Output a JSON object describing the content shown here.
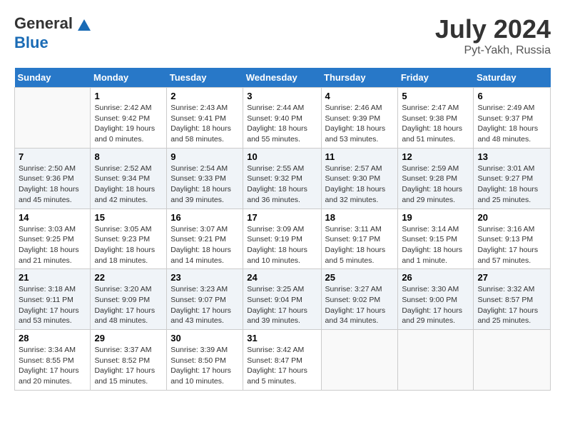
{
  "header": {
    "logo_general": "General",
    "logo_blue": "Blue",
    "month_year": "July 2024",
    "location": "Pyt-Yakh, Russia"
  },
  "days_of_week": [
    "Sunday",
    "Monday",
    "Tuesday",
    "Wednesday",
    "Thursday",
    "Friday",
    "Saturday"
  ],
  "weeks": [
    [
      {
        "day": "",
        "info": ""
      },
      {
        "day": "1",
        "info": "Sunrise: 2:42 AM\nSunset: 9:42 PM\nDaylight: 19 hours\nand 0 minutes."
      },
      {
        "day": "2",
        "info": "Sunrise: 2:43 AM\nSunset: 9:41 PM\nDaylight: 18 hours\nand 58 minutes."
      },
      {
        "day": "3",
        "info": "Sunrise: 2:44 AM\nSunset: 9:40 PM\nDaylight: 18 hours\nand 55 minutes."
      },
      {
        "day": "4",
        "info": "Sunrise: 2:46 AM\nSunset: 9:39 PM\nDaylight: 18 hours\nand 53 minutes."
      },
      {
        "day": "5",
        "info": "Sunrise: 2:47 AM\nSunset: 9:38 PM\nDaylight: 18 hours\nand 51 minutes."
      },
      {
        "day": "6",
        "info": "Sunrise: 2:49 AM\nSunset: 9:37 PM\nDaylight: 18 hours\nand 48 minutes."
      }
    ],
    [
      {
        "day": "7",
        "info": "Sunrise: 2:50 AM\nSunset: 9:36 PM\nDaylight: 18 hours\nand 45 minutes."
      },
      {
        "day": "8",
        "info": "Sunrise: 2:52 AM\nSunset: 9:34 PM\nDaylight: 18 hours\nand 42 minutes."
      },
      {
        "day": "9",
        "info": "Sunrise: 2:54 AM\nSunset: 9:33 PM\nDaylight: 18 hours\nand 39 minutes."
      },
      {
        "day": "10",
        "info": "Sunrise: 2:55 AM\nSunset: 9:32 PM\nDaylight: 18 hours\nand 36 minutes."
      },
      {
        "day": "11",
        "info": "Sunrise: 2:57 AM\nSunset: 9:30 PM\nDaylight: 18 hours\nand 32 minutes."
      },
      {
        "day": "12",
        "info": "Sunrise: 2:59 AM\nSunset: 9:28 PM\nDaylight: 18 hours\nand 29 minutes."
      },
      {
        "day": "13",
        "info": "Sunrise: 3:01 AM\nSunset: 9:27 PM\nDaylight: 18 hours\nand 25 minutes."
      }
    ],
    [
      {
        "day": "14",
        "info": "Sunrise: 3:03 AM\nSunset: 9:25 PM\nDaylight: 18 hours\nand 21 minutes."
      },
      {
        "day": "15",
        "info": "Sunrise: 3:05 AM\nSunset: 9:23 PM\nDaylight: 18 hours\nand 18 minutes."
      },
      {
        "day": "16",
        "info": "Sunrise: 3:07 AM\nSunset: 9:21 PM\nDaylight: 18 hours\nand 14 minutes."
      },
      {
        "day": "17",
        "info": "Sunrise: 3:09 AM\nSunset: 9:19 PM\nDaylight: 18 hours\nand 10 minutes."
      },
      {
        "day": "18",
        "info": "Sunrise: 3:11 AM\nSunset: 9:17 PM\nDaylight: 18 hours\nand 5 minutes."
      },
      {
        "day": "19",
        "info": "Sunrise: 3:14 AM\nSunset: 9:15 PM\nDaylight: 18 hours\nand 1 minute."
      },
      {
        "day": "20",
        "info": "Sunrise: 3:16 AM\nSunset: 9:13 PM\nDaylight: 17 hours\nand 57 minutes."
      }
    ],
    [
      {
        "day": "21",
        "info": "Sunrise: 3:18 AM\nSunset: 9:11 PM\nDaylight: 17 hours\nand 53 minutes."
      },
      {
        "day": "22",
        "info": "Sunrise: 3:20 AM\nSunset: 9:09 PM\nDaylight: 17 hours\nand 48 minutes."
      },
      {
        "day": "23",
        "info": "Sunrise: 3:23 AM\nSunset: 9:07 PM\nDaylight: 17 hours\nand 43 minutes."
      },
      {
        "day": "24",
        "info": "Sunrise: 3:25 AM\nSunset: 9:04 PM\nDaylight: 17 hours\nand 39 minutes."
      },
      {
        "day": "25",
        "info": "Sunrise: 3:27 AM\nSunset: 9:02 PM\nDaylight: 17 hours\nand 34 minutes."
      },
      {
        "day": "26",
        "info": "Sunrise: 3:30 AM\nSunset: 9:00 PM\nDaylight: 17 hours\nand 29 minutes."
      },
      {
        "day": "27",
        "info": "Sunrise: 3:32 AM\nSunset: 8:57 PM\nDaylight: 17 hours\nand 25 minutes."
      }
    ],
    [
      {
        "day": "28",
        "info": "Sunrise: 3:34 AM\nSunset: 8:55 PM\nDaylight: 17 hours\nand 20 minutes."
      },
      {
        "day": "29",
        "info": "Sunrise: 3:37 AM\nSunset: 8:52 PM\nDaylight: 17 hours\nand 15 minutes."
      },
      {
        "day": "30",
        "info": "Sunrise: 3:39 AM\nSunset: 8:50 PM\nDaylight: 17 hours\nand 10 minutes."
      },
      {
        "day": "31",
        "info": "Sunrise: 3:42 AM\nSunset: 8:47 PM\nDaylight: 17 hours\nand 5 minutes."
      },
      {
        "day": "",
        "info": ""
      },
      {
        "day": "",
        "info": ""
      },
      {
        "day": "",
        "info": ""
      }
    ]
  ]
}
